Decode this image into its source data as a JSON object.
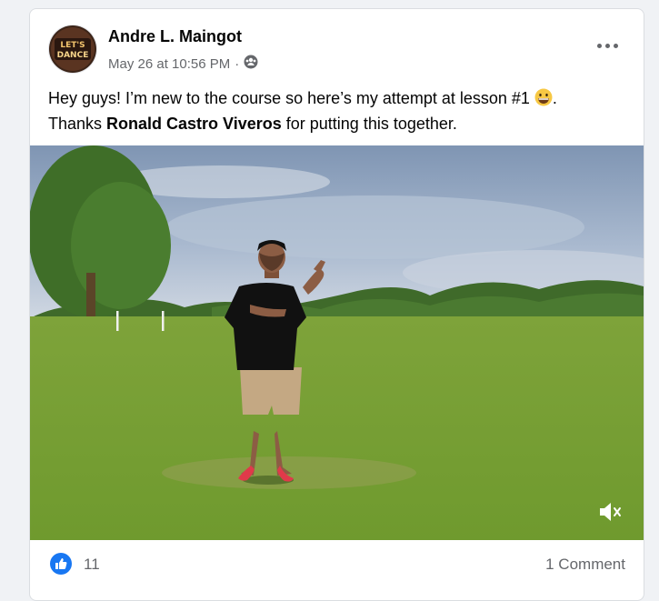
{
  "post": {
    "author": "Andre L. Maingot",
    "avatar_text": "LET'S DANCE",
    "timestamp": "May 26 at 10:56 PM",
    "separator": "·",
    "audience_icon": "group-audience-icon",
    "text_part1": "Hey guys! I’m new to the course so here’s my attempt at lesson #1 ",
    "text_part2": ".",
    "text_part3": "Thanks ",
    "mention": "Ronald Castro Viveros",
    "text_part4": " for putting this together.",
    "emoji": "grinning-face-emoji"
  },
  "video": {
    "state": "muted",
    "icon": "volume-muted-icon"
  },
  "reactions": {
    "like_count": "11",
    "comment_count_label": "1 Comment"
  },
  "colors": {
    "accent": "#1877f2",
    "secondary_text": "#65676b",
    "background": "#f0f2f5"
  }
}
